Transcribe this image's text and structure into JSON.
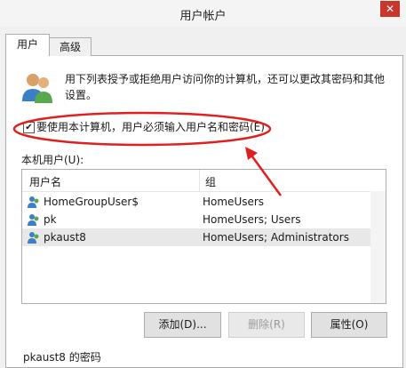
{
  "window": {
    "title": "用户帐户",
    "close_label": "✕"
  },
  "tabs": [
    {
      "label": "用户"
    },
    {
      "label": "高级"
    }
  ],
  "description": "用下列表授予或拒绝用户访问你的计算机，还可以更改其密码和其他设置。",
  "require_login": {
    "label": "要使用本计算机，用户必须输入用户名和密码(E)",
    "checked": true
  },
  "local_users_label": "本机用户(U):",
  "table": {
    "columns": [
      "用户名",
      "组"
    ],
    "rows": [
      {
        "name": "HomeGroupUser$",
        "group": "HomeUsers"
      },
      {
        "name": "pk",
        "group": "HomeUsers; Users"
      },
      {
        "name": "pkaust8",
        "group": "HomeUsers; Administrators",
        "selected": true
      }
    ]
  },
  "buttons": {
    "add": "添加(D)...",
    "remove": "删除(R)",
    "properties": "属性(O)"
  },
  "bottom_label": "pkaust8 的密码",
  "colors": {
    "annotation_red": "#e02020",
    "close_red": "#c9372c"
  }
}
